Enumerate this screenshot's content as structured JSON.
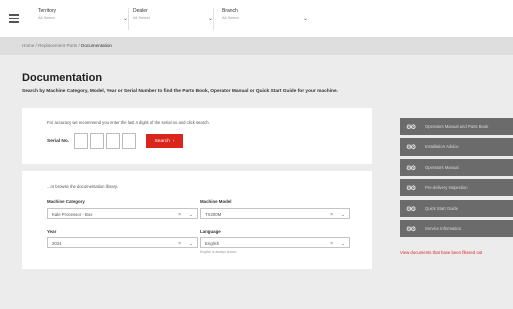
{
  "header": {
    "filters": [
      {
        "label": "Territory",
        "value": "All Select"
      },
      {
        "label": "Dealer",
        "value": "All Select"
      },
      {
        "label": "Branch",
        "value": "All Select"
      }
    ]
  },
  "breadcrumb": {
    "items": [
      "Home",
      "Replacement Parts",
      "Documentation"
    ]
  },
  "page": {
    "title": "Documentation",
    "subtitle": "Search by Machine Category, Model, Year or Serial Number to find the Parts Book, Operator Manual or Quick Start Guide for your machine."
  },
  "serial_search": {
    "note": "For accuracy we recommend you enter the last 4 digits of the serial no and click search.",
    "label": "Serial No.",
    "button_label": "Search",
    "button_icon": "arrow-right-icon"
  },
  "library": {
    "note": "...or browse the documentation library.",
    "category_label": "Machine Category",
    "category_value": "Kale Processor - Box",
    "model_label": "Machine Model",
    "model_value": "TX200M",
    "year_label": "Year",
    "year_value": "2024",
    "language_label": "Language",
    "language_value": "English",
    "language_hint": "English is always shown"
  },
  "doc_menu": {
    "items": [
      "Operators Manual and Parts Book",
      "Installation Advice",
      "Operators Manual",
      "Pre-delivery Inspection",
      "Quick Start Guide",
      "Service Information"
    ],
    "filtered_link": "View documents that have been filtered out"
  },
  "colors": {
    "accent": "#d9251c",
    "menu_bg": "#6b6b6b",
    "page_bg": "#ececec"
  }
}
